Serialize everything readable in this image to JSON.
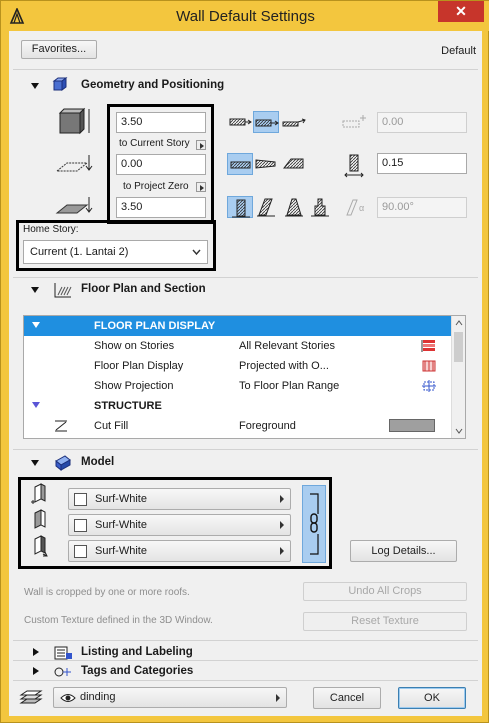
{
  "window": {
    "title": "Wall Default Settings"
  },
  "header": {
    "favorites_label": "Favorites...",
    "default_label": "Default"
  },
  "geometry": {
    "title": "Geometry and Positioning",
    "height_value": "3.50",
    "top_link_label": "to Current Story",
    "bottom_offset_value": "0.00",
    "bottom_link_label": "to Project Zero",
    "thickness_value": "3.50",
    "offset_value": "0.00",
    "slant_thickness_value": "0.15",
    "angle_value": "90.00°",
    "home_story_label": "Home Story:",
    "home_story_value": "Current (1. Lantai 2)"
  },
  "floorplan": {
    "title": "Floor Plan and Section",
    "rows": [
      {
        "kind": "group",
        "label": "FLOOR PLAN DISPLAY"
      },
      {
        "kind": "item",
        "label": "Show on Stories",
        "value": "All Relevant Stories"
      },
      {
        "kind": "item",
        "label": "Floor Plan Display",
        "value": "Projected with O..."
      },
      {
        "kind": "item",
        "label": "Show Projection",
        "value": "To Floor Plan Range"
      },
      {
        "kind": "group",
        "label": "STRUCTURE"
      },
      {
        "kind": "item",
        "label": "Cut Fill",
        "value": "Foreground"
      }
    ],
    "cut_fill_color": "#9f9f9f"
  },
  "model": {
    "title": "Model",
    "materials": [
      "Surf-White",
      "Surf-White",
      "Surf-White"
    ],
    "log_details_label": "Log Details...",
    "crop_note": "Wall is cropped by one or more roofs.",
    "undo_crops_label": "Undo All Crops",
    "texture_note": "Custom Texture defined in the 3D Window.",
    "reset_texture_label": "Reset Texture"
  },
  "collapsed_sections": [
    "Listing and Labeling",
    "Tags and Categories"
  ],
  "footer": {
    "layer_value": "dinding",
    "cancel_label": "Cancel",
    "ok_label": "OK"
  },
  "colors": {
    "title_bar": "#f3c63e",
    "close_button": "#c7352b",
    "selection": "#1f8fe0"
  }
}
